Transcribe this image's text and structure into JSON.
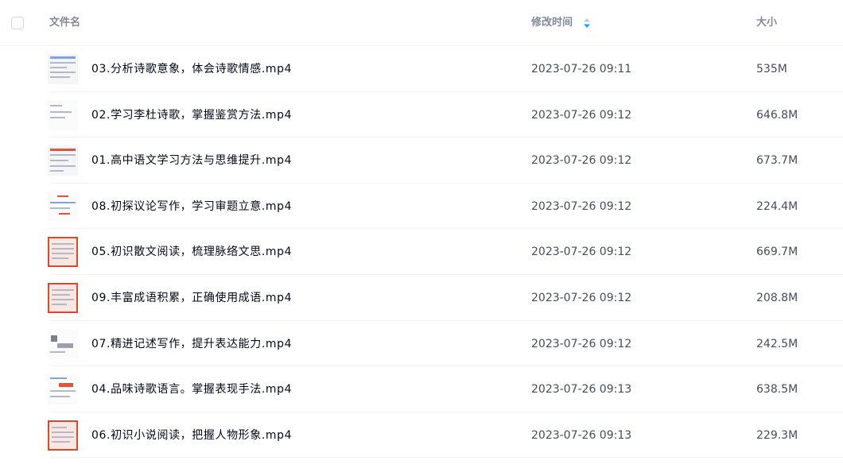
{
  "header": {
    "name_label": "文件名",
    "time_label": "修改时间",
    "size_label": "大小",
    "sort_icon": "sort-toggle-icon",
    "sort_color": "#06a7ff"
  },
  "files": [
    {
      "name": "03.分析诗歌意象，体会诗歌情感.mp4",
      "time": "2023-07-26 09:11",
      "size": "535M"
    },
    {
      "name": "02.学习李杜诗歌，掌握鉴赏方法.mp4",
      "time": "2023-07-26 09:12",
      "size": "646.8M"
    },
    {
      "name": "01.高中语文学习方法与思维提升.mp4",
      "time": "2023-07-26 09:12",
      "size": "673.7M"
    },
    {
      "name": "08.初探议论写作，学习审题立意.mp4",
      "time": "2023-07-26 09:12",
      "size": "224.4M"
    },
    {
      "name": "05.初识散文阅读，梳理脉络文思.mp4",
      "time": "2023-07-26 09:12",
      "size": "669.7M"
    },
    {
      "name": "09.丰富成语积累，正确使用成语.mp4",
      "time": "2023-07-26 09:12",
      "size": "208.8M"
    },
    {
      "name": "07.精进记述写作，提升表达能力.mp4",
      "time": "2023-07-26 09:12",
      "size": "242.5M"
    },
    {
      "name": "04.品味诗歌语言。掌握表现手法.mp4",
      "time": "2023-07-26 09:13",
      "size": "638.5M"
    },
    {
      "name": "06.初识小说阅读，把握人物形象.mp4",
      "time": "2023-07-26 09:13",
      "size": "229.3M"
    }
  ]
}
